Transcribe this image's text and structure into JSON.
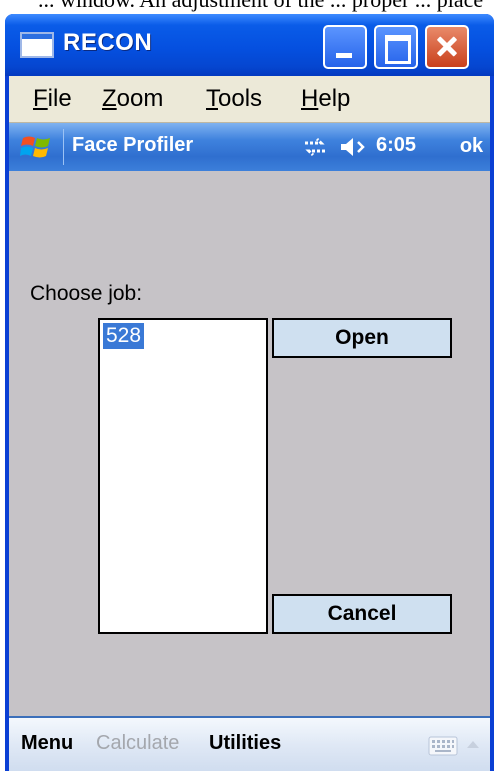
{
  "window": {
    "title": "RECON"
  },
  "top_strip_text": "... window. An adjustment of the ... proper ... place ...",
  "menubar": {
    "items": [
      {
        "label_prefix": "F",
        "label_rest": "ile"
      },
      {
        "label_prefix": "Z",
        "label_rest": "oom"
      },
      {
        "label_prefix": "T",
        "label_rest": "ools"
      },
      {
        "label_prefix": "H",
        "label_rest": "elp"
      }
    ]
  },
  "device_bar": {
    "title": "Face Profiler",
    "time": "6:05",
    "ok_label": "ok",
    "icons": [
      "windows-flag-icon",
      "sync-icon",
      "speaker-icon"
    ]
  },
  "main": {
    "choose_label": "Choose job:",
    "jobs": [
      "528"
    ],
    "selected_job": "528",
    "open_label": "Open",
    "cancel_label": "Cancel"
  },
  "softkeys": {
    "menu": "Menu",
    "calculate": "Calculate",
    "utilities": "Utilities",
    "icons": [
      "keyboard-icon",
      "up-arrow-icon"
    ]
  },
  "colors": {
    "titlebar": "#0550e0",
    "client_bg": "#c6c3c7",
    "menubar_bg": "#ece9d8",
    "device_bar": "#3f82de",
    "selection": "#3a79d6",
    "button_bg": "#cfe0f0",
    "close_button": "#c9401c"
  }
}
